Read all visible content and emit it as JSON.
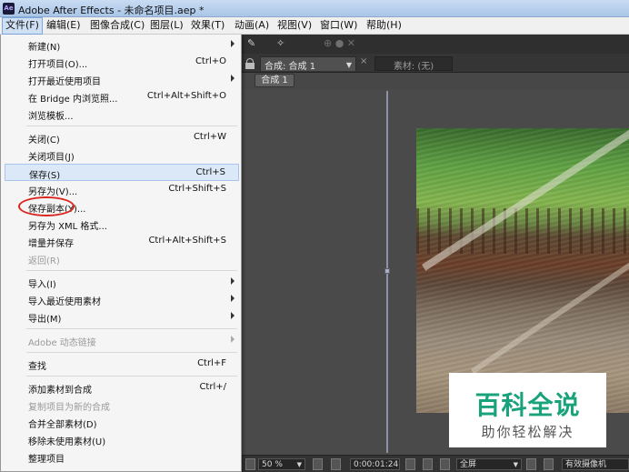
{
  "window": {
    "app_icon": "Ae",
    "title": "Adobe After Effects - 未命名项目.aep *"
  },
  "menubar": [
    {
      "label": "文件(F)"
    },
    {
      "label": "编辑(E)"
    },
    {
      "label": "图像合成(C)"
    },
    {
      "label": "图层(L)"
    },
    {
      "label": "效果(T)"
    },
    {
      "label": "动画(A)"
    },
    {
      "label": "视图(V)"
    },
    {
      "label": "窗口(W)"
    },
    {
      "label": "帮助(H)"
    }
  ],
  "file_menu": [
    {
      "label": "新建(N)",
      "shortcut": "",
      "submenu": true,
      "disabled": false
    },
    {
      "label": "打开项目(O)...",
      "shortcut": "Ctrl+O",
      "submenu": false,
      "disabled": false
    },
    {
      "label": "打开最近使用项目",
      "shortcut": "",
      "submenu": true,
      "disabled": false
    },
    {
      "label": "在 Bridge 内浏览照...",
      "shortcut": "Ctrl+Alt+Shift+O",
      "submenu": false,
      "disabled": false
    },
    {
      "label": "浏览模板...",
      "shortcut": "",
      "submenu": false,
      "disabled": false
    },
    {
      "label": "关闭(C)",
      "shortcut": "Ctrl+W",
      "submenu": false,
      "disabled": false
    },
    {
      "label": "关闭项目(J)",
      "shortcut": "",
      "submenu": false,
      "disabled": false
    },
    {
      "label": "保存(S)",
      "shortcut": "Ctrl+S",
      "submenu": false,
      "disabled": false,
      "highlighted": true
    },
    {
      "label": "另存为(V)...",
      "shortcut": "Ctrl+Shift+S",
      "submenu": false,
      "disabled": false
    },
    {
      "label": "保存副本(Y)...",
      "shortcut": "",
      "submenu": false,
      "disabled": false
    },
    {
      "label": "另存为 XML 格式...",
      "shortcut": "",
      "submenu": false,
      "disabled": false
    },
    {
      "label": "增量并保存",
      "shortcut": "Ctrl+Alt+Shift+S",
      "submenu": false,
      "disabled": false
    },
    {
      "label": "返回(R)",
      "shortcut": "",
      "submenu": false,
      "disabled": true
    },
    {
      "label": "导入(I)",
      "shortcut": "",
      "submenu": true,
      "disabled": false
    },
    {
      "label": "导入最近使用素材",
      "shortcut": "",
      "submenu": true,
      "disabled": false
    },
    {
      "label": "导出(M)",
      "shortcut": "",
      "submenu": true,
      "disabled": false
    },
    {
      "label": "Adobe 动态链接",
      "shortcut": "",
      "submenu": true,
      "disabled": true
    },
    {
      "label": "查找",
      "shortcut": "Ctrl+F",
      "submenu": false,
      "disabled": false
    },
    {
      "label": "添加素材到合成",
      "shortcut": "Ctrl+/",
      "submenu": false,
      "disabled": false
    },
    {
      "label": "复制项目为新的合成",
      "shortcut": "",
      "submenu": false,
      "disabled": true
    },
    {
      "label": "合并全部素材(D)",
      "shortcut": "",
      "submenu": false,
      "disabled": false
    },
    {
      "label": "移除未使用素材(U)",
      "shortcut": "",
      "submenu": false,
      "disabled": false
    },
    {
      "label": "整理项目",
      "shortcut": "",
      "submenu": false,
      "disabled": false
    }
  ],
  "panel": {
    "comp_tab": "合成: 合成 1",
    "source_tab": "素材: (无)",
    "breadcrumb": "合成 1"
  },
  "statusbar": {
    "zoom": "50 %",
    "timecode": "0:00:01:24",
    "resolution": "全屏",
    "camera": "有效摄像机"
  },
  "watermark": {
    "main": "百科全说",
    "sub": "助你轻松解决"
  },
  "colors": {
    "highlight_circle": "#d9261e",
    "watermark_green": "#1aa37b"
  },
  "icons": {
    "lock": "lock-icon",
    "close": "close-icon",
    "dropdown": "chevron-down-icon"
  }
}
